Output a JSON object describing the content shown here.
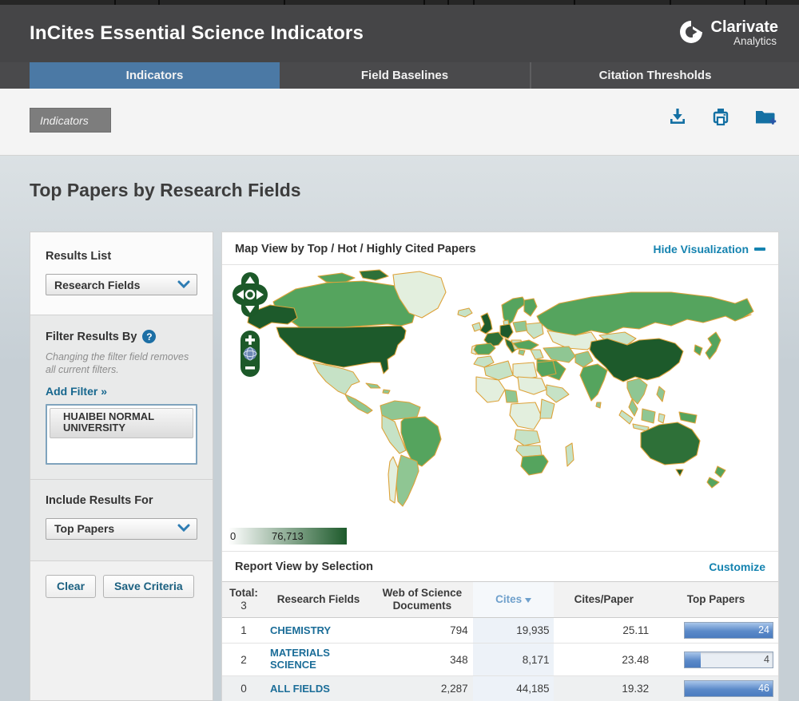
{
  "header": {
    "title": "InCites Essential Science Indicators",
    "logo": {
      "line1": "Clarivate",
      "line2": "Analytics"
    }
  },
  "tabs": [
    {
      "label": "Indicators"
    },
    {
      "label": "Field Baselines"
    },
    {
      "label": "Citation Thresholds"
    }
  ],
  "toolbar": {
    "breadcrumb": "Indicators"
  },
  "page": {
    "title": "Top Papers by Research Fields"
  },
  "sidebar": {
    "results_list": {
      "label": "Results List",
      "value": "Research Fields"
    },
    "filter": {
      "label": "Filter Results By",
      "help": "?",
      "note": "Changing the filter field removes all current filters.",
      "add_filter": "Add Filter »",
      "selected_filter": "HUAIBEI NORMAL UNIVERSITY"
    },
    "include": {
      "label": "Include Results For",
      "value": "Top Papers"
    },
    "buttons": {
      "clear": "Clear",
      "save": "Save Criteria"
    }
  },
  "map": {
    "title": "Map View by Top / Hot / Highly Cited Papers",
    "hide_link": "Hide Visualization",
    "legend": {
      "min": "0",
      "max": "76,713"
    },
    "region_colors": {
      "alaska": "#1d5a2b",
      "canada": "#55a45e",
      "arctic1": "#55a45e",
      "arctic2": "#2e7038",
      "greenland": "#e3efde",
      "iceland": "#c6e2c6",
      "usa": "#1d5a2b",
      "mexico": "#c6e2c6",
      "centam": "#8fc693",
      "cuba": "#8fc693",
      "hispaniola": "#8fc693",
      "colombia_ven": "#8fc693",
      "brazil": "#55a45e",
      "peru": "#c6e2c6",
      "argentina": "#8fc693",
      "chile": "#e3efde",
      "ireland": "#c6e2c6",
      "uk": "#1d5a2b",
      "norway_sweden": "#55a45e",
      "finland": "#55a45e",
      "denmark": "#c6e2c6",
      "germany": "#1d5a2b",
      "france": "#2e7038",
      "spain": "#55a45e",
      "portugal": "#e3efde",
      "italy": "#2e7038",
      "poland": "#8fc693",
      "ukraine": "#c6e2c6",
      "balkans": "#c6e2c6",
      "greece": "#8fc693",
      "russia": "#55a45e",
      "kazakhstan": "#e3efde",
      "mongolia": "#c6e2c6",
      "china": "#1d5a2b",
      "pakistan": "#8fc693",
      "india": "#55a45e",
      "srilanka": "#8fc693",
      "iran": "#8fc693",
      "turkey": "#55a45e",
      "iraq": "#c6e2c6",
      "saudi": "#55a45e",
      "japan": "#55a45e",
      "korea": "#55a45e",
      "indochina": "#8fc693",
      "malay": "#8fc693",
      "sumatra": "#c6e2c6",
      "java": "#c6e2c6",
      "borneo": "#8fc693",
      "sulawesi": "#c6e2c6",
      "png": "#55a45e",
      "philippines": "#8fc693",
      "morocco": "#c6e2c6",
      "algeria": "#c6e2c6",
      "libya": "#e3efde",
      "egypt": "#55a45e",
      "westafrica": "#e3efde",
      "nigeria": "#8fc693",
      "sudan": "#e3efde",
      "horn": "#c6e2c6",
      "drc": "#e3efde",
      "eastafrica": "#c6e2c6",
      "angola": "#c6e2c6",
      "botswana": "#c6e2c6",
      "southafrica": "#55a45e",
      "madagascar": "#c6e2c6",
      "australia": "#2e7038",
      "tasmania": "#1d5a2b",
      "nz1": "#55a45e",
      "nz2": "#55a45e"
    }
  },
  "report": {
    "title": "Report View by Selection",
    "customize": "Customize",
    "total_label": "Total:",
    "total_value": "3",
    "columns": {
      "fields": "Research Fields",
      "docs": "Web of Science Documents",
      "cites": "Cites",
      "cpp": "Cites/Paper",
      "top": "Top Papers"
    },
    "rows": [
      {
        "rank": "1",
        "field": "CHEMISTRY",
        "docs": "794",
        "cites": "19,935",
        "cpp": "25.11",
        "top": "24",
        "bar_pct": 100
      },
      {
        "rank": "2",
        "field": "MATERIALS SCIENCE",
        "docs": "348",
        "cites": "8,171",
        "cpp": "23.48",
        "top": "4",
        "bar_pct": 18
      },
      {
        "rank": "0",
        "field": "ALL FIELDS",
        "docs": "2,287",
        "cites": "44,185",
        "cpp": "19.32",
        "top": "46",
        "bar_pct": 100
      }
    ]
  }
}
